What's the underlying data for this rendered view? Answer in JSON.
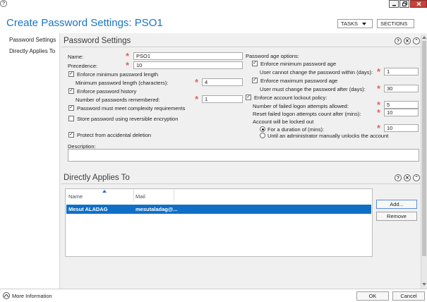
{
  "window": {
    "title": "Create Password Settings: PSO1",
    "tasks_label": "TASKS",
    "sections_label": "SECTIONS"
  },
  "sidebar": {
    "items": [
      {
        "label": "Password Settings"
      },
      {
        "label": "Directly Applies To"
      }
    ]
  },
  "password_settings": {
    "heading": "Password Settings",
    "name_label": "Name:",
    "name_value": "PSO1",
    "precedence_label": "Precedence:",
    "precedence_value": "10",
    "enforce_min_length_label": "Enforce minimum password length",
    "min_length_label": "Minimum password length (characters):",
    "min_length_value": "4",
    "enforce_history_label": "Enforce password history",
    "history_label": "Number of passwords remembered:",
    "history_value": "1",
    "complexity_label": "Password must meet complexity requirements",
    "reversible_label": "Store password using reversible encryption",
    "protect_label": "Protect from accidental deletion",
    "description_label": "Description:",
    "age_options_label": "Password age options:",
    "enforce_min_age_label": "Enforce minimum password age",
    "min_age_label": "User cannot change the password within (days):",
    "min_age_value": "1",
    "enforce_max_age_label": "Enforce maximum password age",
    "max_age_label": "User must change the password after (days):",
    "max_age_value": "30",
    "lockout_policy_label": "Enforce account lockout policy:",
    "failed_attempts_label": "Number of failed logon attempts allowed:",
    "failed_attempts_value": "5",
    "reset_label": "Reset failed logon attempts count after (mins):",
    "reset_value": "10",
    "locked_out_label": "Account will be locked out",
    "duration_label": "For a duration of (mins):",
    "duration_value": "10",
    "manual_unlock_label": "Until an administrator manually unlocks the account"
  },
  "applies_to": {
    "heading": "Directly Applies To",
    "columns": [
      "Name",
      "Mail"
    ],
    "rows": [
      {
        "name": "Mesut ALADAG",
        "mail": "mesutaladag@..."
      }
    ],
    "add_label": "Add...",
    "remove_label": "Remove"
  },
  "footer": {
    "more_info_label": "More Information",
    "ok_label": "OK",
    "cancel_label": "Cancel"
  },
  "colors": {
    "title": "#1a74c4",
    "selected_row": "#0f6fc6",
    "required_star": "#e06464",
    "panel_bg": "#f0f0f0"
  }
}
